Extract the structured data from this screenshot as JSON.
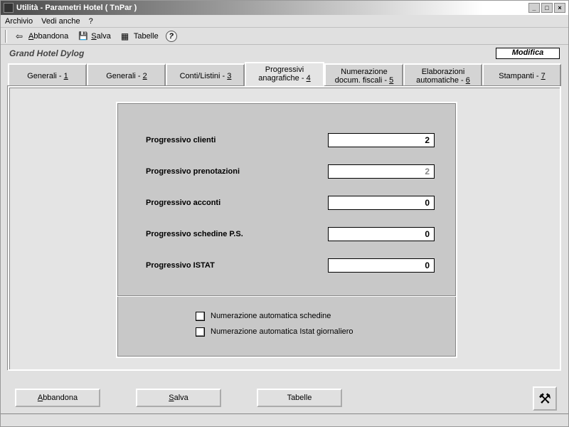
{
  "window": {
    "title": "Utilità - Parametri Hotel ( TnPar )"
  },
  "menu": {
    "archivio": "Archivio",
    "vedianche": "Vedi anche",
    "help": "?"
  },
  "toolbar": {
    "abbandona": "Abbandona",
    "salva": "Salva",
    "tabelle": "Tabelle"
  },
  "hotel_name": "Grand Hotel Dylog",
  "mode_label": "Modifica",
  "tabs": [
    {
      "label": "Generali - ",
      "key": "1"
    },
    {
      "label": "Generali - ",
      "key": "2"
    },
    {
      "label": "Conti/Listini - ",
      "key": "3"
    },
    {
      "label_line1": "Progressivi",
      "label_line2": "anagrafiche - ",
      "key": "4"
    },
    {
      "label_line1": "Numerazione",
      "label_line2": "docum. fiscali - ",
      "key": "5"
    },
    {
      "label_line1": "Elaborazioni",
      "label_line2": "automatiche - ",
      "key": "6"
    },
    {
      "label": "Stampanti - ",
      "key": "7"
    }
  ],
  "form": {
    "rows": [
      {
        "label": "Progressivo clienti",
        "value": "2",
        "disabled": false
      },
      {
        "label": "Progressivo prenotazioni",
        "value": "2",
        "disabled": true
      },
      {
        "label": "Progressivo acconti",
        "value": "0",
        "disabled": false
      },
      {
        "label": "Progressivo schedine P.S.",
        "value": "0",
        "disabled": false
      },
      {
        "label": "Progressivo ISTAT",
        "value": "0",
        "disabled": false
      }
    ],
    "checks": [
      {
        "label": "Numerazione automatica schedine",
        "checked": false
      },
      {
        "label": "Numerazione automatica Istat giornaliero",
        "checked": false
      }
    ]
  },
  "buttons": {
    "abbandona": "Abbandona",
    "salva": "Salva",
    "tabelle": "Tabelle"
  }
}
